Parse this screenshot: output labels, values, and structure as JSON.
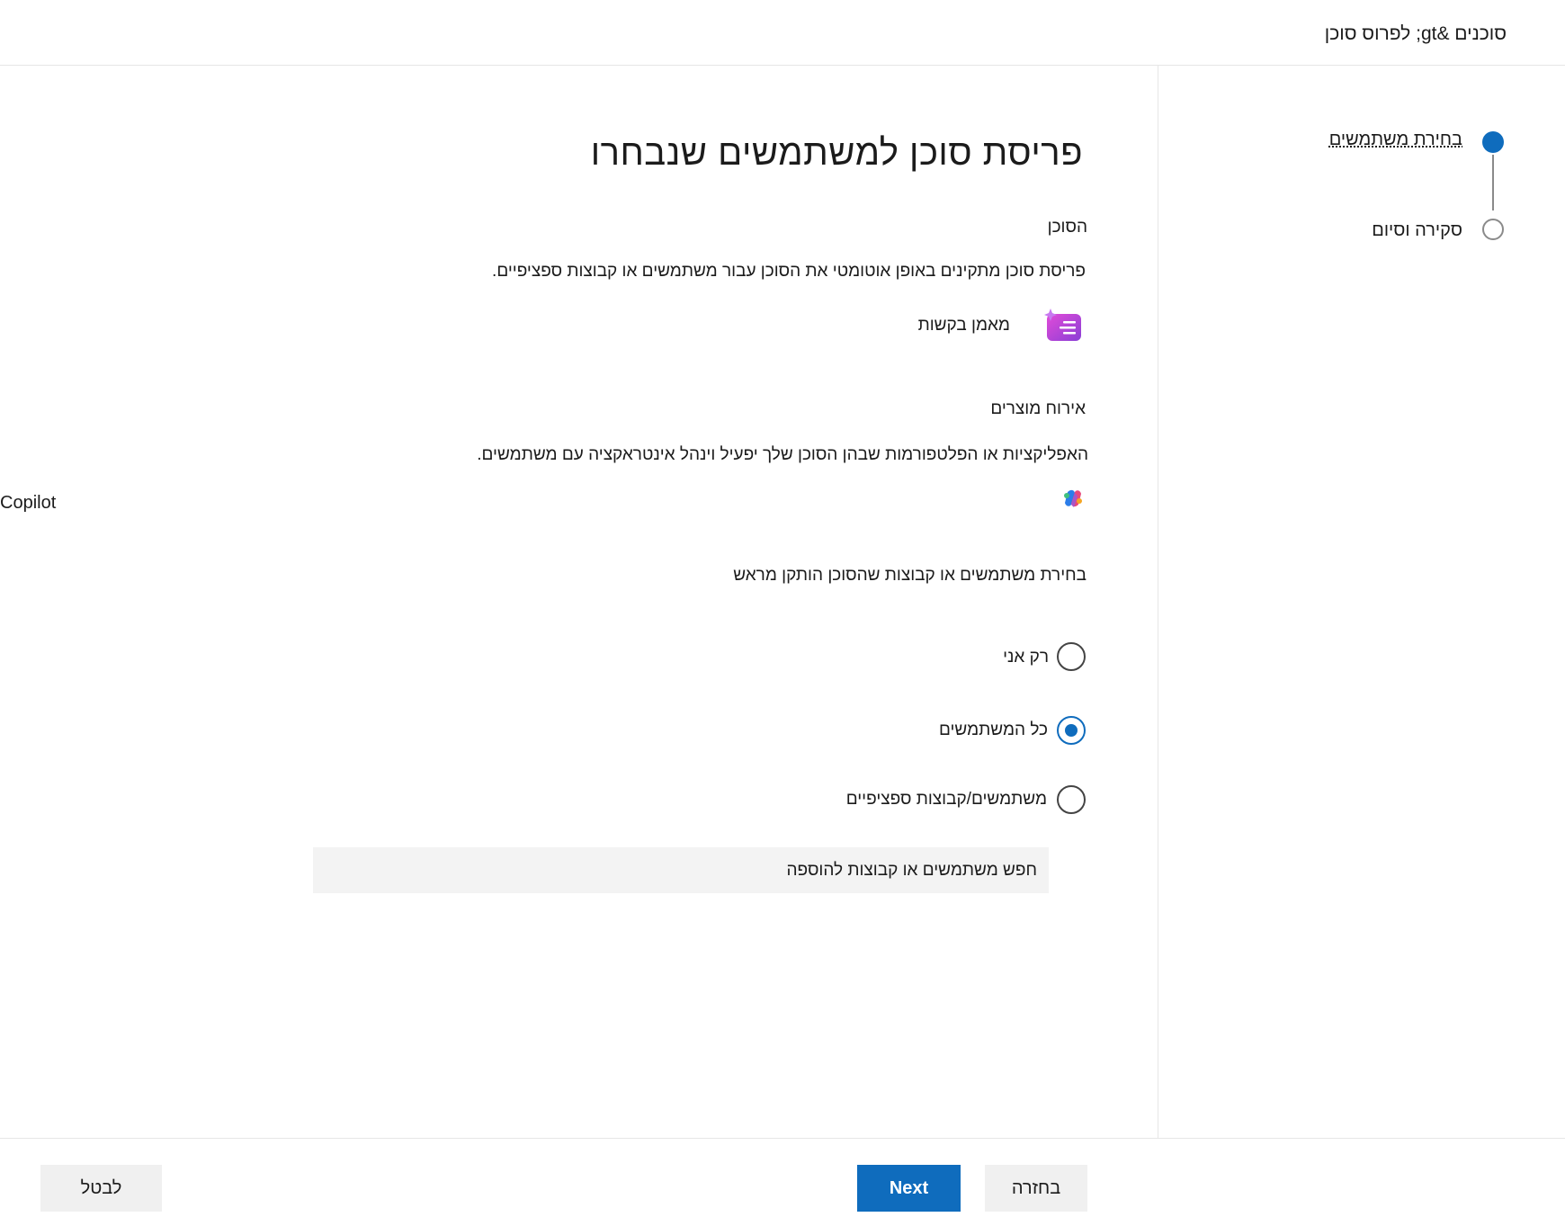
{
  "header": {
    "breadcrumb": "סוכנים &gt; לפרוס סוכן"
  },
  "steps": [
    {
      "label": "בחירת משתמשים",
      "state": "active"
    },
    {
      "label": "סקירה וסיום",
      "state": "pending"
    }
  ],
  "main": {
    "title": "פריסת סוכן למשתמשים שנבחרו",
    "agent_section_label": "הסוכן",
    "agent_description": "פריסת סוכן מתקינים באופן אוטומטי את הסוכן עבור משתמשים או קבוצות ספציפיים.",
    "agent_name": "מאמן בקשות",
    "hosting_label": "אירוח מוצרים",
    "hosting_description": "האפליקציות או הפלטפורמות שבהן הסוכן שלך יפעיל וינהל אינטראקציה עם משתמשים.",
    "host_product": "Copilot",
    "choose_label": "בחירת משתמשים או קבוצות שהסוכן הותקן מראש",
    "options": [
      {
        "label": "רק אני",
        "selected": false
      },
      {
        "label": "כל המשתמשים",
        "selected": true
      },
      {
        "label": "משתמשים/קבוצות ספציפיים",
        "selected": false
      }
    ],
    "search_placeholder": "חפש משתמשים או קבוצות להוספה"
  },
  "footer": {
    "next_label": "Next",
    "back_label": "בחזרה",
    "cancel_label": "לבטל"
  },
  "colors": {
    "accent": "#0f6cbd"
  }
}
